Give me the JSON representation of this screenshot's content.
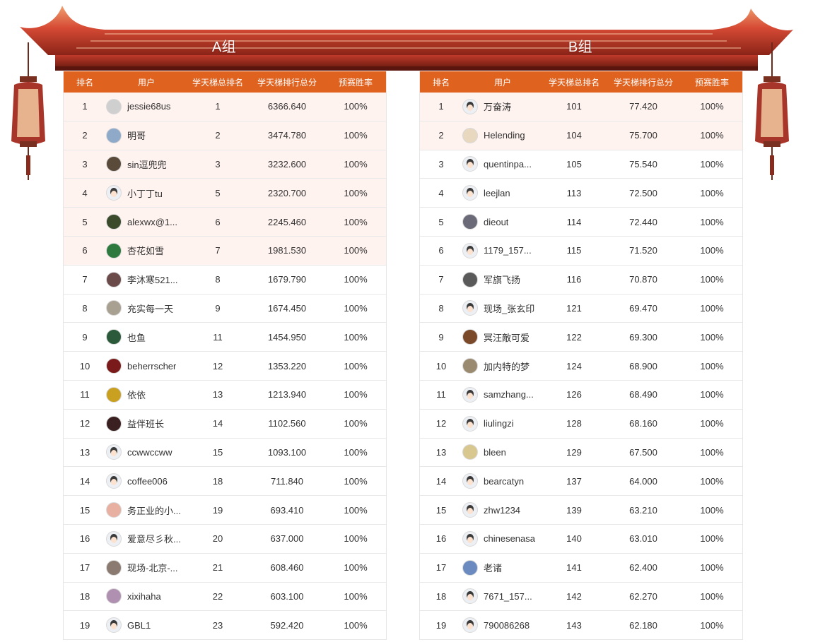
{
  "groups": [
    {
      "title": "A组",
      "headers": [
        "排名",
        "用户",
        "学天梯总排名",
        "学天梯排行总分",
        "预赛胜率"
      ],
      "rows": [
        {
          "rank": "1",
          "user": "jessie68us",
          "total_rank": "1",
          "score": "6366.640",
          "rate": "100%",
          "avatar_color": "#cfcfcf",
          "highlight": true
        },
        {
          "rank": "2",
          "user": "明哥",
          "total_rank": "2",
          "score": "3474.780",
          "rate": "100%",
          "avatar_color": "#8fa9c9",
          "highlight": true
        },
        {
          "rank": "3",
          "user": "sin逗兜兜",
          "total_rank": "3",
          "score": "3232.600",
          "rate": "100%",
          "avatar_color": "#5a4a3a",
          "highlight": true
        },
        {
          "rank": "4",
          "user": "小丁丁tu",
          "total_rank": "5",
          "score": "2320.700",
          "rate": "100%",
          "avatar_color": "default",
          "highlight": true
        },
        {
          "rank": "5",
          "user": "alexwx@1...",
          "total_rank": "6",
          "score": "2245.460",
          "rate": "100%",
          "avatar_color": "#3b4a2a",
          "highlight": true
        },
        {
          "rank": "6",
          "user": "杏花如雪",
          "total_rank": "7",
          "score": "1981.530",
          "rate": "100%",
          "avatar_color": "#2e7a3e",
          "highlight": true
        },
        {
          "rank": "7",
          "user": "李沐寒521...",
          "total_rank": "8",
          "score": "1679.790",
          "rate": "100%",
          "avatar_color": "#6b4a4a",
          "highlight": false
        },
        {
          "rank": "8",
          "user": "充实每一天",
          "total_rank": "9",
          "score": "1674.450",
          "rate": "100%",
          "avatar_color": "#a8a090",
          "highlight": false
        },
        {
          "rank": "9",
          "user": "也鱼",
          "total_rank": "11",
          "score": "1454.950",
          "rate": "100%",
          "avatar_color": "#2a5a3a",
          "highlight": false
        },
        {
          "rank": "10",
          "user": "beherrscher",
          "total_rank": "12",
          "score": "1353.220",
          "rate": "100%",
          "avatar_color": "#7a1a1a",
          "highlight": false
        },
        {
          "rank": "11",
          "user": "依依",
          "total_rank": "13",
          "score": "1213.940",
          "rate": "100%",
          "avatar_color": "#c9a020",
          "highlight": false
        },
        {
          "rank": "12",
          "user": "益伴班长",
          "total_rank": "14",
          "score": "1102.560",
          "rate": "100%",
          "avatar_color": "#3a2020",
          "highlight": false
        },
        {
          "rank": "13",
          "user": "ccwwccww",
          "total_rank": "15",
          "score": "1093.100",
          "rate": "100%",
          "avatar_color": "default",
          "highlight": false
        },
        {
          "rank": "14",
          "user": "coffee006",
          "total_rank": "18",
          "score": "711.840",
          "rate": "100%",
          "avatar_color": "default",
          "highlight": false
        },
        {
          "rank": "15",
          "user": "务正业的小...",
          "total_rank": "19",
          "score": "693.410",
          "rate": "100%",
          "avatar_color": "#e8b0a0",
          "highlight": false
        },
        {
          "rank": "16",
          "user": "爱意尽彡秋...",
          "total_rank": "20",
          "score": "637.000",
          "rate": "100%",
          "avatar_color": "default",
          "highlight": false
        },
        {
          "rank": "17",
          "user": "现场-北京-...",
          "total_rank": "21",
          "score": "608.460",
          "rate": "100%",
          "avatar_color": "#8a7a70",
          "highlight": false
        },
        {
          "rank": "18",
          "user": "xixihaha",
          "total_rank": "22",
          "score": "603.100",
          "rate": "100%",
          "avatar_color": "#b090b0",
          "highlight": false
        },
        {
          "rank": "19",
          "user": "GBL1",
          "total_rank": "23",
          "score": "592.420",
          "rate": "100%",
          "avatar_color": "default",
          "highlight": false
        }
      ]
    },
    {
      "title": "B组",
      "headers": [
        "排名",
        "用户",
        "学天梯总排名",
        "学天梯排行总分",
        "预赛胜率"
      ],
      "rows": [
        {
          "rank": "1",
          "user": "万奋涛",
          "total_rank": "101",
          "score": "77.420",
          "rate": "100%",
          "avatar_color": "default",
          "highlight": true
        },
        {
          "rank": "2",
          "user": "Helending",
          "total_rank": "104",
          "score": "75.700",
          "rate": "100%",
          "avatar_color": "#e8d8c0",
          "highlight": true
        },
        {
          "rank": "3",
          "user": "quentinpa...",
          "total_rank": "105",
          "score": "75.540",
          "rate": "100%",
          "avatar_color": "default",
          "highlight": false
        },
        {
          "rank": "4",
          "user": "leejlan",
          "total_rank": "113",
          "score": "72.500",
          "rate": "100%",
          "avatar_color": "default",
          "highlight": false
        },
        {
          "rank": "5",
          "user": "dieout",
          "total_rank": "114",
          "score": "72.440",
          "rate": "100%",
          "avatar_color": "#6a6a78",
          "highlight": false
        },
        {
          "rank": "6",
          "user": "1179_157...",
          "total_rank": "115",
          "score": "71.520",
          "rate": "100%",
          "avatar_color": "default",
          "highlight": false
        },
        {
          "rank": "7",
          "user": "军旗飞扬",
          "total_rank": "116",
          "score": "70.870",
          "rate": "100%",
          "avatar_color": "#5a5a5a",
          "highlight": false
        },
        {
          "rank": "8",
          "user": "现场_张玄印",
          "total_rank": "121",
          "score": "69.470",
          "rate": "100%",
          "avatar_color": "default",
          "highlight": false
        },
        {
          "rank": "9",
          "user": "冥汪敵可爱",
          "total_rank": "122",
          "score": "69.300",
          "rate": "100%",
          "avatar_color": "#7a4a2a",
          "highlight": false
        },
        {
          "rank": "10",
          "user": "加内特的梦",
          "total_rank": "124",
          "score": "68.900",
          "rate": "100%",
          "avatar_color": "#9a8a70",
          "highlight": false
        },
        {
          "rank": "11",
          "user": "samzhang...",
          "total_rank": "126",
          "score": "68.490",
          "rate": "100%",
          "avatar_color": "default",
          "highlight": false
        },
        {
          "rank": "12",
          "user": "liulingzi",
          "total_rank": "128",
          "score": "68.160",
          "rate": "100%",
          "avatar_color": "default",
          "highlight": false
        },
        {
          "rank": "13",
          "user": "bleen",
          "total_rank": "129",
          "score": "67.500",
          "rate": "100%",
          "avatar_color": "#d8c890",
          "highlight": false
        },
        {
          "rank": "14",
          "user": "bearcatyn",
          "total_rank": "137",
          "score": "64.000",
          "rate": "100%",
          "avatar_color": "default",
          "highlight": false
        },
        {
          "rank": "15",
          "user": "zhw1234",
          "total_rank": "139",
          "score": "63.210",
          "rate": "100%",
          "avatar_color": "default",
          "highlight": false
        },
        {
          "rank": "16",
          "user": "chinesenasa",
          "total_rank": "140",
          "score": "63.010",
          "rate": "100%",
          "avatar_color": "default",
          "highlight": false
        },
        {
          "rank": "17",
          "user": "老诸",
          "total_rank": "141",
          "score": "62.400",
          "rate": "100%",
          "avatar_color": "#6a8ac0",
          "highlight": false
        },
        {
          "rank": "18",
          "user": "7671_157...",
          "total_rank": "142",
          "score": "62.270",
          "rate": "100%",
          "avatar_color": "default",
          "highlight": false
        },
        {
          "rank": "19",
          "user": "790086268",
          "total_rank": "143",
          "score": "62.180",
          "rate": "100%",
          "avatar_color": "default",
          "highlight": false
        }
      ]
    }
  ],
  "colors": {
    "header_bg": "#e0621f",
    "highlight_row_bg": "#fff3ef",
    "roof_red": "#c8392b",
    "roof_orange": "#e9874a"
  }
}
